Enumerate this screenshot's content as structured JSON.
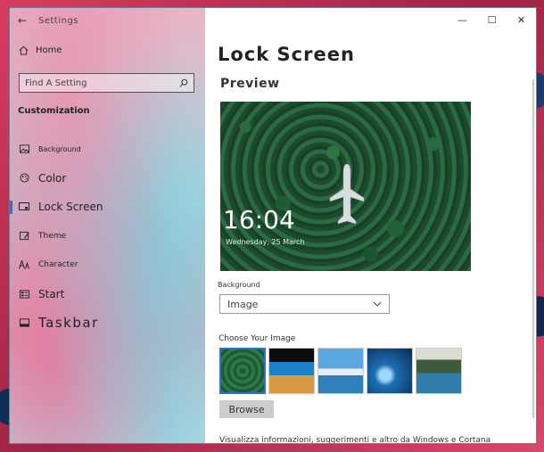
{
  "window": {
    "app_title": "Settings",
    "controls": {
      "minimize": "—",
      "maximize": "☐",
      "close": "✕"
    }
  },
  "sidebar": {
    "back": "←",
    "home": "Home",
    "search_placeholder": "Find A Setting",
    "section": "Customization",
    "items": [
      {
        "label": "Background",
        "icon": "image-icon"
      },
      {
        "label": "Color",
        "icon": "palette-icon"
      },
      {
        "label": "Lock Screen",
        "icon": "lock-screen-icon",
        "selected": true
      },
      {
        "label": "Theme",
        "icon": "theme-icon"
      },
      {
        "label": "Character",
        "icon": "font-icon"
      },
      {
        "label": "Start",
        "icon": "start-icon"
      },
      {
        "label": "Taskbar",
        "icon": "taskbar-icon"
      }
    ]
  },
  "main": {
    "title": "Lock Screen",
    "preview_label": "Preview",
    "preview": {
      "time": "16:04",
      "date": "Wednesday, 25 March"
    },
    "background_label": "Background",
    "background_value": "Image",
    "choose_label": "Choose Your Image",
    "browse": "Browse",
    "info": "Visualizza informazioni, suggerimenti e altro da Windows e Cortana"
  },
  "colors": {
    "accent": "#2b6fd6"
  }
}
